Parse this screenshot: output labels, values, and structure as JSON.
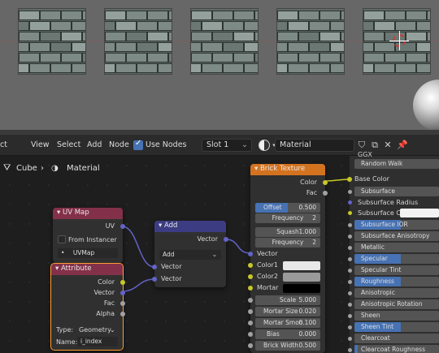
{
  "header": {
    "menu_partial": "ct",
    "menus": [
      "View",
      "Select",
      "Add",
      "Node"
    ],
    "use_nodes_label": "Use Nodes",
    "slot": "Slot 1",
    "material": "Material"
  },
  "breadcrumb": {
    "object": "Cube",
    "material": "Material"
  },
  "nodes": {
    "uvmap": {
      "title": "UV Map",
      "out_uv": "UV",
      "from_instancer": "From Instancer",
      "map": "UVMap"
    },
    "attribute": {
      "title": "Attribute",
      "out_color": "Color",
      "out_vector": "Vector",
      "out_fac": "Fac",
      "out_alpha": "Alpha",
      "type_label": "Type:",
      "type_value": "Geometry",
      "name_label": "Name:",
      "name_value": "i_index"
    },
    "add": {
      "title": "Add",
      "out_vector": "Vector",
      "operation": "Add",
      "in_vector1": "Vector",
      "in_vector2": "Vector"
    },
    "brick": {
      "title": "Brick Texture",
      "out_color": "Color",
      "out_fac": "Fac",
      "offset_label": "Offset",
      "offset_value": "0.500",
      "freq1_label": "Frequency",
      "freq1_value": "2",
      "squash_label": "Squash",
      "squash_value": "1.000",
      "freq2_label": "Frequency",
      "freq2_value": "2",
      "in_vector": "Vector",
      "color1": "Color1",
      "color2": "Color2",
      "mortar": "Mortar",
      "scale_label": "Scale",
      "scale_value": "5.000",
      "mortar_size_label": "Mortar Size",
      "mortar_size_value": "0.020",
      "mortar_smooth_label": "Mortar Smoo",
      "mortar_smooth_value": "0.100",
      "bias_label": "Bias",
      "bias_value": "0.000",
      "brick_width_label": "Brick Width",
      "brick_width_value": "0.500"
    }
  },
  "panel": {
    "ggx": "GGX",
    "random_walk": "Random Walk",
    "base_color": "Base Color",
    "items": [
      "Subsurface",
      "Subsurface Radius",
      "Subsurface C...",
      "Subsurface IOR",
      "Subsurface Anisotropy",
      "Metallic",
      "Specular",
      "Specular Tint",
      "Roughness",
      "Anisotropic",
      "Anisotropic Rotation",
      "Sheen",
      "Sheen Tint",
      "Clearcoat",
      "Clearcoat Roughness"
    ]
  },
  "colors": {
    "accent": "#4772b3",
    "uvmap_header": "#83314a",
    "add_header": "#3c3c83",
    "brick_header": "#d4731f",
    "selection": "#ff9d33",
    "socket_vector": "#6363c7",
    "socket_color": "#c7c729"
  }
}
